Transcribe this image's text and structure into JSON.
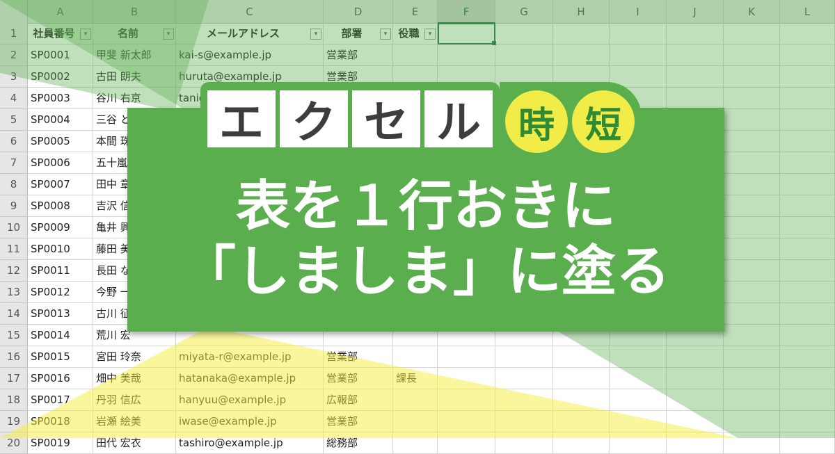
{
  "spreadsheet": {
    "columns": [
      "A",
      "B",
      "C",
      "D",
      "E",
      "F",
      "G",
      "H",
      "I",
      "J",
      "K",
      "L"
    ],
    "active_column": "F",
    "header_row": [
      "社員番号",
      "名前",
      "メールアドレス",
      "部署",
      "役職"
    ],
    "rows": [
      [
        "SP0001",
        "甲斐 新太郎",
        "kai-s@example.jp",
        "営業部",
        ""
      ],
      [
        "SP0002",
        "古田 朗夫",
        "huruta@example.jp",
        "営業部",
        ""
      ],
      [
        "SP0003",
        "谷川 右京",
        "tanig",
        "",
        ""
      ],
      [
        "SP0004",
        "三谷 と",
        "",
        "",
        ""
      ],
      [
        "SP0005",
        "本間 珠",
        "",
        "",
        ""
      ],
      [
        "SP0006",
        "五十嵐",
        "",
        "",
        ""
      ],
      [
        "SP0007",
        "田中 章",
        "",
        "",
        ""
      ],
      [
        "SP0008",
        "吉沢 信",
        "",
        "",
        ""
      ],
      [
        "SP0009",
        "亀井 興",
        "",
        "",
        ""
      ],
      [
        "SP0010",
        "藤田 美",
        "",
        "",
        ""
      ],
      [
        "SP0011",
        "長田 な",
        "",
        "",
        ""
      ],
      [
        "SP0012",
        "今野 一",
        "",
        "",
        ""
      ],
      [
        "SP0013",
        "古川 征",
        "",
        "",
        ""
      ],
      [
        "SP0014",
        "荒川 宏",
        "",
        "",
        ""
      ],
      [
        "SP0015",
        "宮田 玲奈",
        "miyata-r@example.jp",
        "営業部",
        ""
      ],
      [
        "SP0016",
        "畑中 美哉",
        "hatanaka@example.jp",
        "営業部",
        "課長"
      ],
      [
        "SP0017",
        "丹羽 信広",
        "hanyuu@example.jp",
        "広報部",
        ""
      ],
      [
        "SP0018",
        "岩瀬 絵美",
        "iwase@example.jp",
        "営業部",
        ""
      ],
      [
        "SP0019",
        "田代 宏衣",
        "tashiro@example.jp",
        "総務部",
        ""
      ]
    ]
  },
  "title": {
    "boxes": [
      "エ",
      "ク",
      "セ",
      "ル"
    ],
    "circles": [
      "時",
      "短"
    ]
  },
  "subtitle": {
    "line1": "表を１行おきに",
    "line2": "「しましま」に塗る"
  },
  "colors": {
    "banner": "#5aae4e",
    "green_tint": "#5aae4e",
    "yellow_tint": "#f6ee3a",
    "selection": "#217346"
  }
}
